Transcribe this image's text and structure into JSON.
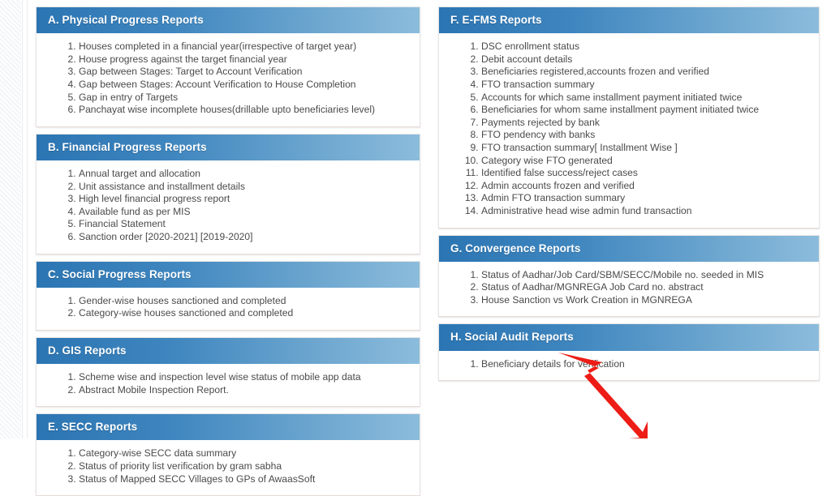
{
  "theme": {
    "header_gradient_start": "#2b75b3",
    "header_gradient_end": "#8cbcdc",
    "header_text_color": "#ffffff",
    "body_text_color": "#4a4a4a",
    "annotation_color": "#ED1C16",
    "page_background": "#ffffff"
  },
  "columns": [
    {
      "name": "left-column",
      "cards": [
        {
          "id": "physical-progress-reports",
          "title": "A. Physical Progress Reports",
          "items": [
            "Houses completed in a financial year(irrespective of target year)",
            "House progress against the target financial year",
            "Gap between Stages: Target to Account Verification",
            "Gap between Stages: Account Verification to House Completion",
            "Gap in entry of Targets",
            "Panchayat wise incomplete houses(drillable upto beneficiaries level)"
          ]
        },
        {
          "id": "financial-progress-reports",
          "title": "B. Financial Progress Reports",
          "items": [
            "Annual target and allocation",
            "Unit assistance and installment details",
            "High level financial progress report",
            "Available fund as per MIS",
            "Financial Statement",
            "Sanction order [2020-2021] [2019-2020]"
          ]
        },
        {
          "id": "social-progress-reports",
          "title": "C. Social Progress Reports",
          "items": [
            "Gender-wise houses sanctioned and completed",
            "Category-wise houses sanctioned and completed"
          ]
        },
        {
          "id": "gis-reports",
          "title": "D. GIS Reports",
          "items": [
            "Scheme wise and inspection level wise status of mobile app data",
            "Abstract Mobile Inspection Report."
          ]
        },
        {
          "id": "secc-reports",
          "title": "E. SECC Reports",
          "items": [
            "Category-wise SECC data summary",
            "Status of priority list verification by gram sabha",
            "Status of Mapped SECC Villages to GPs of AwaasSoft"
          ]
        }
      ]
    },
    {
      "name": "right-column",
      "cards": [
        {
          "id": "e-fms-reports",
          "title": "F. E-FMS Reports",
          "items": [
            "DSC enrollment status",
            "Debit account details",
            "Beneficiaries registered,accounts frozen and verified",
            "FTO transaction summary",
            "Accounts for which same installment payment initiated twice",
            "Beneficiaries for whom same installment payment initiated twice",
            "Payments rejected by bank",
            "FTO pendency with banks",
            "FTO transaction summary[ Installment Wise ]",
            "Category wise FTO generated",
            "Identified false success/reject cases",
            "Admin accounts frozen and verified",
            "Admin FTO transaction summary",
            "Administrative head wise admin fund transaction"
          ]
        },
        {
          "id": "convergence-reports",
          "title": "G. Convergence Reports",
          "items": [
            "Status of Aadhar/Job Card/SBM/SECC/Mobile no. seeded in MIS",
            "Status of Aadhar/MGNREGA Job Card no. abstract",
            "House Sanction vs Work Creation in MGNREGA"
          ]
        },
        {
          "id": "social-audit-reports",
          "title": "H. Social Audit Reports",
          "items": [
            "Beneficiary details for verification"
          ]
        }
      ]
    }
  ],
  "annotation": {
    "type": "arrow",
    "points_to": "Beneficiary details for verification",
    "color": "#ED1C16"
  }
}
